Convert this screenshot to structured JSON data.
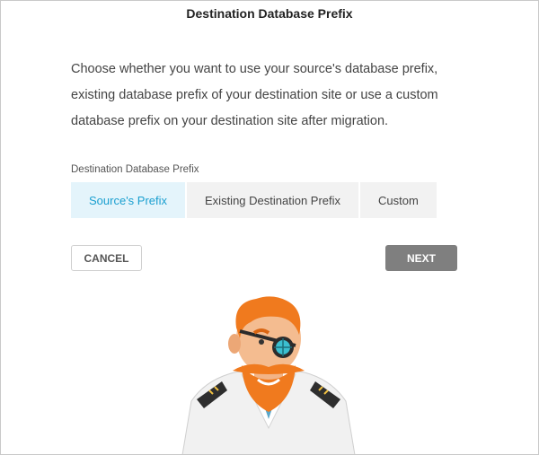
{
  "dialog": {
    "title": "Destination Database Prefix",
    "description": "Choose whether you want to use your source's database prefix, existing database prefix of your destination site or use a custom database prefix on your destination site after migration.",
    "field_label": "Destination Database Prefix"
  },
  "prefix_options": {
    "selected": "Source's Prefix",
    "items": [
      {
        "label": "Source's Prefix"
      },
      {
        "label": "Existing Destination Prefix"
      },
      {
        "label": "Custom"
      }
    ]
  },
  "actions": {
    "cancel_label": "CANCEL",
    "next_label": "NEXT"
  },
  "colors": {
    "accent": "#1a9fd0",
    "active_bg": "#e4f4fb",
    "next_bg": "#7f7f7f"
  },
  "illustration": {
    "icon": "captain-mascot-illustration"
  }
}
